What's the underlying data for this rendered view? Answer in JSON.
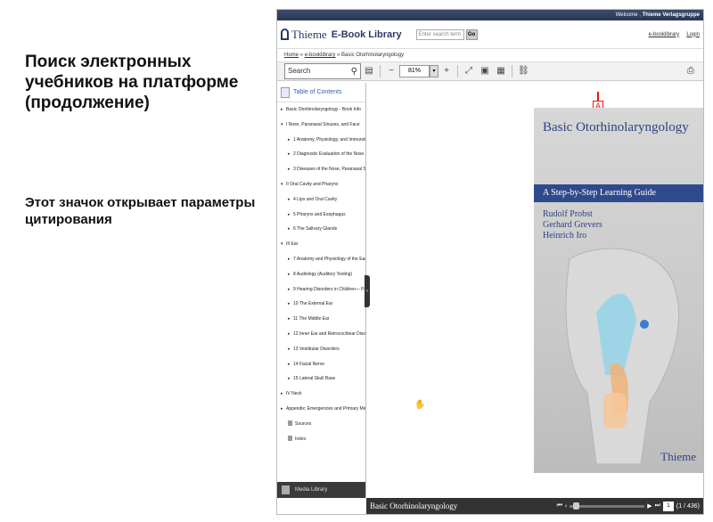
{
  "slide": {
    "title": "Поиск электронных учебников на платформе (продолжение)",
    "note": "Этот значок открывает параметры цитирования"
  },
  "app": {
    "welcome": "Welcome ,",
    "welcome_user": "Thieme Verlagsgruppe",
    "logo": "Thieme",
    "product": "E-Book Library",
    "search_placeholder": "Enter search term",
    "go": "Go",
    "links": [
      "e-booklibrary",
      "Login"
    ],
    "breadcrumb": {
      "home": "Home",
      "lib": "e-booklibrary",
      "current": "» Basic Otorhinolaryngology"
    },
    "sidebar_search": "Search",
    "zoom": "81%",
    "toc_title": "Table of Contents",
    "toc": [
      {
        "t": "Basic Otorhinolaryngology - Book Info",
        "lvl": 0,
        "arrow": "▸"
      },
      {
        "t": "I Nose, Paranasal Sinuses, and Face",
        "lvl": 0,
        "arrow": "▾"
      },
      {
        "t": "1 Anatomy, Physiology, and Immunol",
        "lvl": 1,
        "arrow": "▸"
      },
      {
        "t": "2 Diagnostic Evaluation of the Nose a",
        "lvl": 1,
        "arrow": "▸"
      },
      {
        "t": "3 Diseases of the Nose, Paranasal Sinu",
        "lvl": 1,
        "arrow": "▸"
      },
      {
        "t": "II Oral Cavity and Pharynx",
        "lvl": 0,
        "arrow": "▾"
      },
      {
        "t": "4 Lips and Oral Cavity",
        "lvl": 1,
        "arrow": "▸"
      },
      {
        "t": "5 Pharynx and Esophagus",
        "lvl": 1,
        "arrow": "▸"
      },
      {
        "t": "6 The Salivary Glands",
        "lvl": 1,
        "arrow": "▸"
      },
      {
        "t": "III Ear",
        "lvl": 0,
        "arrow": "▾"
      },
      {
        "t": "7 Anatomy and Physiology of the Ear",
        "lvl": 1,
        "arrow": "▸"
      },
      {
        "t": "8 Audiology (Auditory Testing)",
        "lvl": 1,
        "arrow": "▸"
      },
      {
        "t": "9 Hearing Disorders in Children— Ped",
        "lvl": 1,
        "arrow": "▸"
      },
      {
        "t": "10 The External Ear",
        "lvl": 1,
        "arrow": "▸"
      },
      {
        "t": "11 The Middle Ear",
        "lvl": 1,
        "arrow": "▸"
      },
      {
        "t": "12 Inner Ear and Retrocochlear Disord",
        "lvl": 1,
        "arrow": "▸"
      },
      {
        "t": "13 Vestibular Disorders",
        "lvl": 1,
        "arrow": "▸"
      },
      {
        "t": "14 Facial Nerve",
        "lvl": 1,
        "arrow": "▸"
      },
      {
        "t": "15 Lateral Skull Base",
        "lvl": 1,
        "arrow": "▸"
      },
      {
        "t": "IV Neck",
        "lvl": 0,
        "arrow": "▸"
      },
      {
        "t": "Appendix: Emergencies and Primary Mea",
        "lvl": 0,
        "arrow": "▸"
      },
      {
        "t": "Sources",
        "lvl": 1,
        "arrow": "doc"
      },
      {
        "t": "Index",
        "lvl": 1,
        "arrow": "doc"
      }
    ],
    "media_library": "Media Library",
    "cover": {
      "title": "Basic Otorhinolaryngology",
      "subtitle": "A Step-by-Step Learning Guide",
      "authors": [
        "Rudolf Probst",
        "Gerhard Grevers",
        "Heinrich Iro"
      ],
      "publisher": "Thieme"
    },
    "bottom_title": "Basic Otorhinolaryngology",
    "page_current": "1",
    "page_total": "(1 / 436)",
    "marker": "A"
  },
  "colors": {
    "accent_red": "#ee1111",
    "brand_blue": "#2e4380"
  }
}
